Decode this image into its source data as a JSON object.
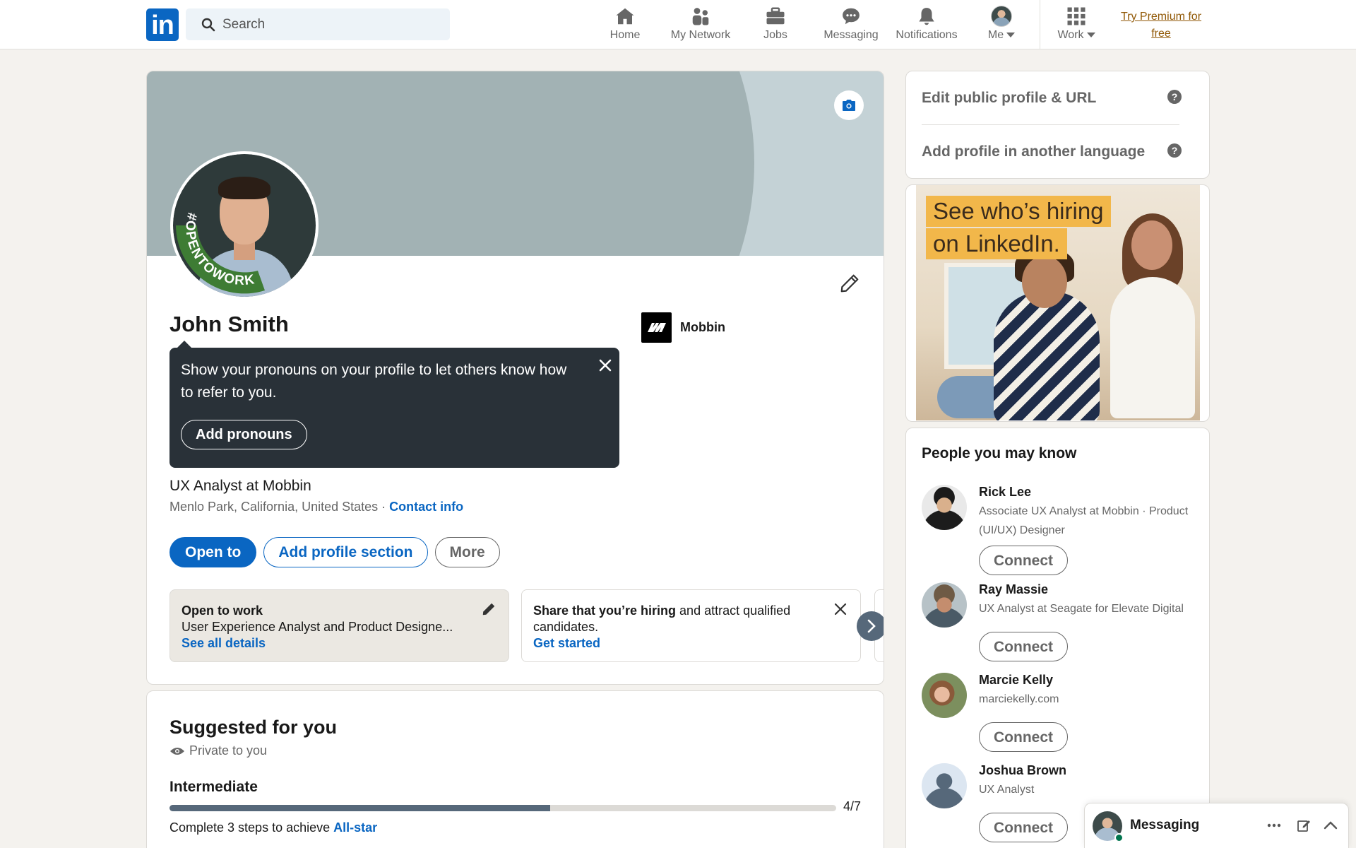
{
  "nav": {
    "logo": "in",
    "search_placeholder": "Search",
    "items": [
      {
        "label": "Home",
        "icon": "home-icon"
      },
      {
        "label": "My Network",
        "icon": "network-icon"
      },
      {
        "label": "Jobs",
        "icon": "briefcase-icon"
      },
      {
        "label": "Messaging",
        "icon": "message-icon"
      },
      {
        "label": "Notifications",
        "icon": "bell-icon"
      },
      {
        "label": "Me",
        "icon": "avatar"
      },
      {
        "label": "Work",
        "icon": "grid-icon"
      }
    ],
    "premium": "Try Premium for free"
  },
  "profile": {
    "name": "John Smith",
    "badge_text": "#OPENTOWORK",
    "company": "Mobbin",
    "tooltip": {
      "text": "Show your pronouns on your profile to let others know how to refer to you.",
      "button": "Add pronouns"
    },
    "headline": "UX Analyst at Mobbin",
    "location": "Menlo Park, California, United States",
    "separator": " · ",
    "contact": "Contact info",
    "actions": {
      "open_to": "Open to",
      "add_section": "Add profile section",
      "more": "More"
    },
    "open_to_work": {
      "title": "Open to work",
      "roles": "User Experience Analyst and Product Designe...",
      "link": "See all details"
    },
    "hiring": {
      "bold": "Share that you’re hiring",
      "rest": " and attract qualified candidates.",
      "link": "Get started"
    }
  },
  "suggested": {
    "title": "Suggested for you",
    "private": "Private to you",
    "level": "Intermediate",
    "progress": 0.571,
    "count": "4/7",
    "steps_prefix": "Complete 3 steps to achieve ",
    "steps_link": "All-star"
  },
  "sidebar": {
    "edit_public": "Edit public profile & URL",
    "add_language": "Add profile in another language",
    "ad": {
      "line1": "See who’s hiring",
      "line2": "on LinkedIn."
    },
    "pymk": {
      "title": "People you may know",
      "connect": "Connect",
      "people": [
        {
          "name": "Rick Lee",
          "title": "Associate UX Analyst at Mobbin · Product (UI/UX) Designer"
        },
        {
          "name": "Ray Massie",
          "title": "UX Analyst at Seagate for Elevate Digital"
        },
        {
          "name": "Marcie Kelly",
          "title": "marciekelly.com"
        },
        {
          "name": "Joshua Brown",
          "title": "UX Analyst"
        }
      ]
    }
  },
  "messaging": {
    "label": "Messaging"
  },
  "colors": {
    "brand": "#0a66c2",
    "premium": "#915907",
    "tooltip_bg": "#293138",
    "page_bg": "#f4f2ee"
  }
}
